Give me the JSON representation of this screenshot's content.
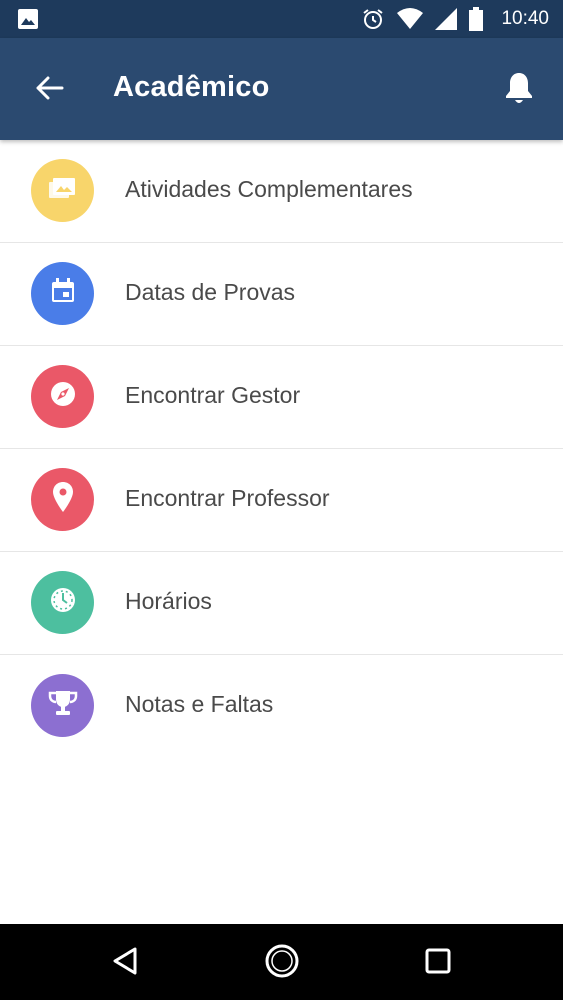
{
  "status_bar": {
    "time": "10:40",
    "icons": [
      "image-icon",
      "alarm-icon",
      "wifi-icon",
      "signal-icon",
      "battery-icon"
    ]
  },
  "app_bar": {
    "title": "Acadêmico",
    "back_icon": "arrow-left-icon",
    "notification_icon": "bell-icon",
    "color": "#2b4a70"
  },
  "menu": {
    "items": [
      {
        "label": "Atividades Complementares",
        "icon": "image-icon",
        "color": "#f8d56b"
      },
      {
        "label": "Datas de Provas",
        "icon": "calendar-icon",
        "color": "#4a7de8"
      },
      {
        "label": "Encontrar Gestor",
        "icon": "compass-icon",
        "color": "#ea5868"
      },
      {
        "label": "Encontrar Professor",
        "icon": "location-pin-icon",
        "color": "#ea5868"
      },
      {
        "label": "Horários",
        "icon": "clock-icon",
        "color": "#4dbf9f"
      },
      {
        "label": "Notas e Faltas",
        "icon": "trophy-icon",
        "color": "#8c6fd1"
      }
    ]
  },
  "nav_bar": {
    "buttons": [
      "back-triangle-icon",
      "home-circle-icon",
      "recents-square-icon"
    ]
  }
}
